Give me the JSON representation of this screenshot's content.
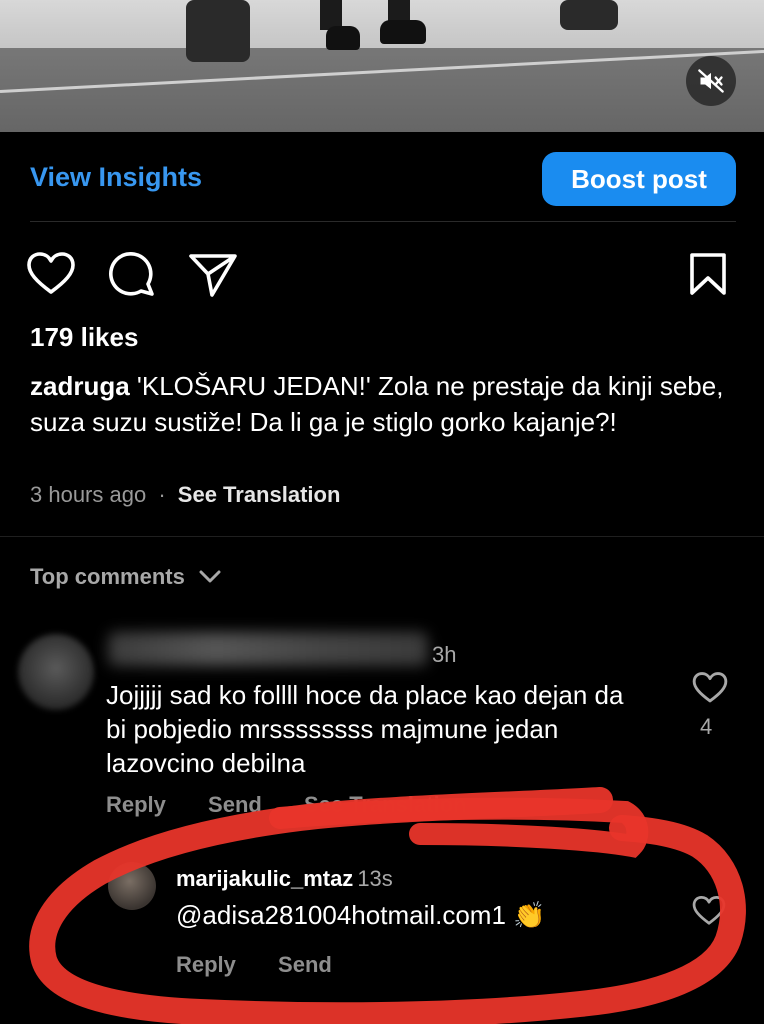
{
  "video": {
    "mute_icon": "speaker-muted-icon"
  },
  "insights": {
    "view_insights_label": "View Insights",
    "boost_label": "Boost post"
  },
  "actions": {
    "like_icon": "heart-icon",
    "comment_icon": "comment-bubble-icon",
    "share_icon": "paper-plane-icon",
    "save_icon": "bookmark-icon"
  },
  "post": {
    "likes": "179 likes",
    "username": "zadruga",
    "caption": " 'KLOŠARU JEDAN!' Zola ne prestaje da kinji sebe, suza suzu sustiže! Da li ga je stiglo gorko kajanje?!",
    "time": "3 hours ago",
    "separator": "·",
    "see_translation": "See Translation"
  },
  "comments_header": {
    "label": "Top comments",
    "icon": "chevron-down-icon"
  },
  "comments": [
    {
      "time": "3h",
      "text": "Jojjjjj sad ko follll hoce da place kao dejan da bi pobjedio mrssssssss majmune jedan lazovcino debilna",
      "like_count": "4",
      "reply_label": "Reply",
      "send_label": "Send",
      "translate_label": "See Translation"
    },
    {
      "username": "marijakulic_mtaz",
      "time": "13s",
      "text": "@adisa281004hotmail.com1 👏",
      "reply_label": "Reply",
      "send_label": "Send"
    }
  ],
  "colors": {
    "background": "#000000",
    "link_blue": "#3897f0",
    "boost_blue": "#1a8cf0",
    "secondary_text": "#a8a8a8",
    "marker_red": "#e8352a"
  }
}
